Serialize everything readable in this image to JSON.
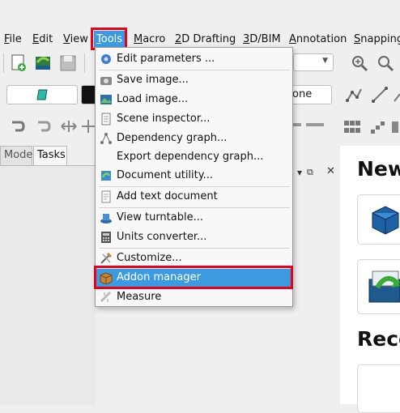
{
  "menubar": {
    "items": [
      {
        "label": "File",
        "mnemonic": "F"
      },
      {
        "label": "Edit",
        "mnemonic": "E"
      },
      {
        "label": "View",
        "mnemonic": "V"
      },
      {
        "label": "Tools",
        "mnemonic": "T"
      },
      {
        "label": "Macro",
        "mnemonic": "M"
      },
      {
        "label": "2D Drafting",
        "mnemonic": "2"
      },
      {
        "label": "3D/BIM",
        "mnemonic": "3"
      },
      {
        "label": "Annotation",
        "mnemonic": "A"
      },
      {
        "label": "Snapping",
        "mnemonic": "S"
      }
    ]
  },
  "toolbar": {
    "none_label": "one"
  },
  "panel": {
    "tabs": [
      {
        "label": "Model"
      },
      {
        "label": "Tasks"
      }
    ]
  },
  "start": {
    "new_heading": "New",
    "recent_heading": "Reco"
  },
  "tools_menu": {
    "items": [
      {
        "label": "Edit parameters ...",
        "icon": "gear-icon"
      },
      {
        "label": "Save image...",
        "icon": "camera-icon"
      },
      {
        "label": "Load image...",
        "icon": "image-icon"
      },
      {
        "label": "Scene inspector...",
        "icon": "document-icon"
      },
      {
        "label": "Dependency graph...",
        "icon": "graph-icon"
      },
      {
        "label": "Export dependency graph...",
        "icon": ""
      },
      {
        "label": "Document utility...",
        "icon": "document-utility-icon"
      },
      {
        "label": "Add text document",
        "icon": "text-document-icon"
      },
      {
        "label": "View turntable...",
        "icon": "turntable-icon"
      },
      {
        "label": "Units converter...",
        "icon": "calculator-icon"
      },
      {
        "label": "Customize...",
        "icon": "customize-icon"
      },
      {
        "label": "Addon manager",
        "icon": "addon-box-icon"
      },
      {
        "label": "Measure",
        "icon": "ruler-icon"
      }
    ]
  },
  "colors": {
    "highlight": "#3c9be0",
    "annotation_box": "#e8001c"
  }
}
